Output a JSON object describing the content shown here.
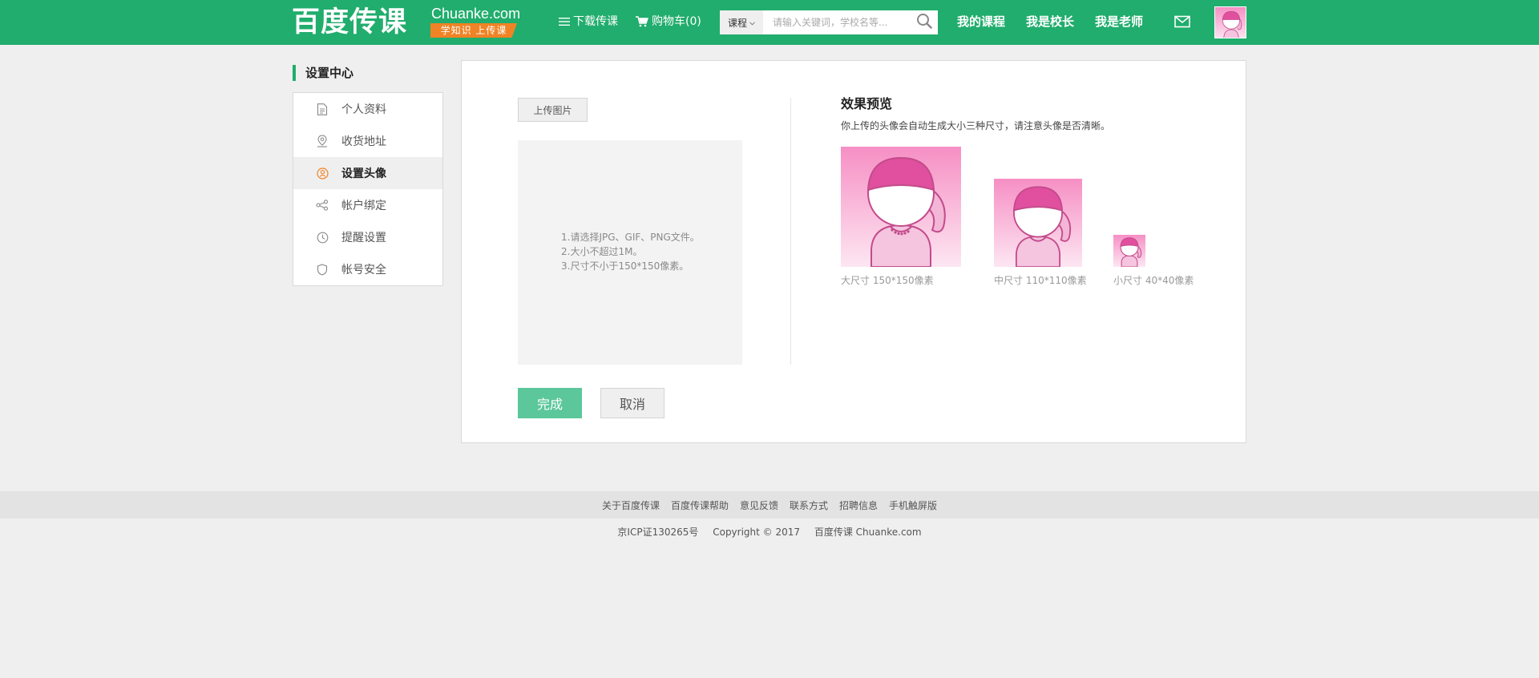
{
  "header": {
    "logo_main": "百度传课",
    "logo_sub": "Chuanke.com",
    "logo_slogan": "学知识 上传课",
    "download": "下载传课",
    "cart": "购物车(0)",
    "search_type": "课程",
    "search_placeholder": "请输入关键词，学校名等...",
    "nav": [
      "我的课程",
      "我是校长",
      "我是老师"
    ]
  },
  "sidebar": {
    "title": "设置中心",
    "items": [
      {
        "label": "个人资料",
        "icon": "document-icon"
      },
      {
        "label": "收货地址",
        "icon": "location-pin-icon"
      },
      {
        "label": "设置头像",
        "icon": "avatar-circle-icon",
        "active": true
      },
      {
        "label": "帐户绑定",
        "icon": "share-link-icon"
      },
      {
        "label": "提醒设置",
        "icon": "clock-icon"
      },
      {
        "label": "帐号安全",
        "icon": "shield-icon"
      }
    ]
  },
  "main": {
    "upload_button": "上传图片",
    "tips": [
      "1.请选择JPG、GIF、PNG文件。",
      "2.大小不超过1M。",
      "3.尺寸不小于150*150像素。"
    ],
    "preview_title": "效果预览",
    "preview_desc": "你上传的头像会自动生成大小三种尺寸，请注意头像是否清晰。",
    "previews": [
      {
        "label": "大尺寸 150*150像素"
      },
      {
        "label": "中尺寸 110*110像素"
      },
      {
        "label": "小尺寸 40*40像素"
      }
    ],
    "confirm_button": "完成",
    "cancel_button": "取消"
  },
  "footer": {
    "links": [
      "关于百度传课",
      "百度传课帮助",
      "意见反馈",
      "联系方式",
      "招聘信息",
      "手机触屏版"
    ],
    "icp": "京ICP证130265号",
    "copyright": "Copyright © 2017",
    "brand": "百度传课 Chuanke.com"
  },
  "colors": {
    "brand_green": "#21ad6d",
    "slogan_orange": "#f08325",
    "confirm_green": "#5bc79b",
    "avatar_pink": "#e0509e"
  }
}
